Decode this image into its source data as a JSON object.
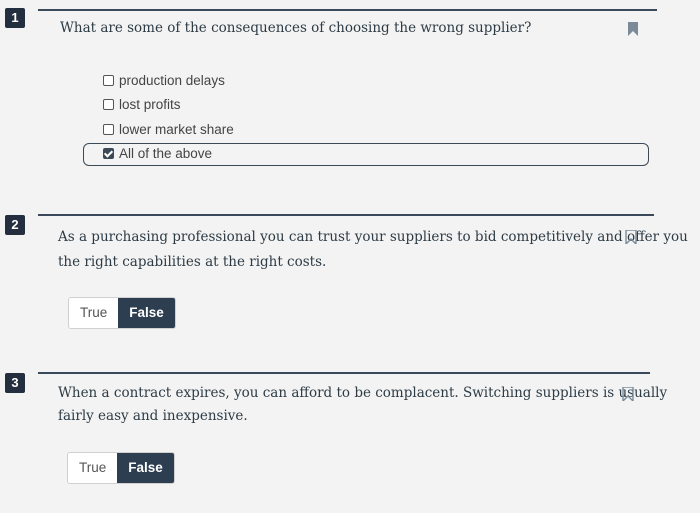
{
  "questions": [
    {
      "number": "1",
      "text": "What are some of the consequences of choosing the wrong supplier?",
      "options": [
        {
          "label": "production delays",
          "checked": false
        },
        {
          "label": "lost profits",
          "checked": false
        },
        {
          "label": "lower market share",
          "checked": false
        },
        {
          "label": "All of the above",
          "checked": true
        }
      ]
    },
    {
      "number": "2",
      "text_line1": "As a purchasing professional you can trust your suppliers to bid competitively and offer you",
      "text_line2": "the right capabilities at the right costs.",
      "true_label": "True",
      "false_label": "False",
      "selected": "False"
    },
    {
      "number": "3",
      "text_line1": "When a contract expires, you can afford to be complacent. Switching suppliers is usually",
      "text_line2": "fairly easy and inexpensive.",
      "true_label": "True",
      "false_label": "False",
      "selected": "False"
    }
  ],
  "colors": {
    "badge": "#232f3e",
    "active_button": "#2c3e50",
    "flag": "#7a8a99"
  },
  "icons": {
    "flag": "bookmark-flag-icon",
    "checkbox": "checkbox-icon"
  }
}
